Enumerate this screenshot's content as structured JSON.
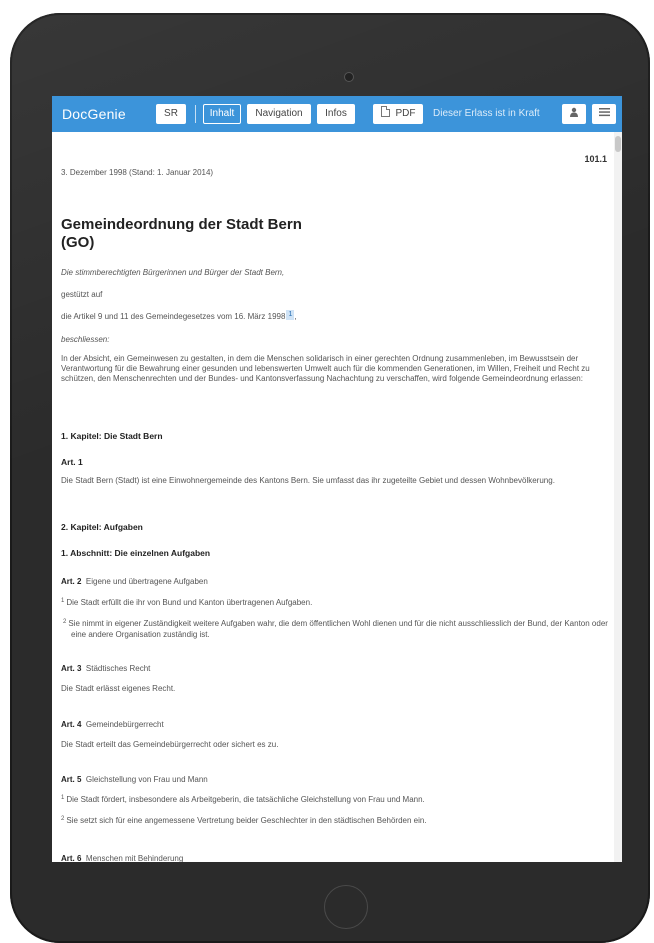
{
  "app": {
    "brand": "DocGenie",
    "buttons": {
      "sr": "SR",
      "inhalt": "Inhalt",
      "navigation": "Navigation",
      "infos": "Infos",
      "pdf": "PDF"
    },
    "status": "Dieser Erlass ist in Kraft",
    "icons": [
      "user-icon",
      "menu-icon",
      "pdf-file-icon",
      "camera-icon",
      "home-button"
    ],
    "colors": {
      "topbar": "#3c94da",
      "device": "#2b2b2b"
    }
  },
  "doc": {
    "sr_number": "101.1",
    "date": "3. Dezember 1998 (Stand: 1. Januar 2014)",
    "title_line1": "Gemeindeordnung der Stadt Bern",
    "title_line2": "(GO)",
    "intro1": "Die stimmberechtigten Bürgerinnen und Bürger der Stadt Bern,",
    "intro2": "gestützt auf",
    "intro3": "die Artikel 9 und 11 des Gemeindegesetzes vom 16. März 1998",
    "intro3_fn": "1",
    "intro3_end": ",",
    "intro4": "beschliessen:",
    "preamble": "In der Absicht, ein Gemeinwesen zu gestalten, in dem die Menschen solidarisch in einer gerechten Ordnung zusammenleben, im Bewusstsein der Verantwortung für die Bewahrung einer gesunden und lebenswerten Umwelt auch für die kommenden Generationen, im Willen, Freiheit und Recht zu schützen, den Menschenrechten und der Bundes- und Kantonsverfassung Nachachtung zu verschaffen, wird folgende Gemeindeordnung erlassen:",
    "chapter1": "1. Kapitel: Die Stadt Bern",
    "art1_title": "Art. 1",
    "art1_text": "Die Stadt Bern (Stadt) ist eine Einwohnergemeinde des Kantons Bern. Sie umfasst das ihr zugeteilte Gebiet und dessen Wohnbevölkerung.",
    "chapter2": "2. Kapitel: Aufgaben",
    "section1": "1. Abschnitt: Die einzelnen Aufgaben",
    "art2_num": "Art. 2",
    "art2_name": "Eigene und übertragene Aufgaben",
    "art2_p1_num": "1",
    "art2_p1": "Die Stadt erfüllt die ihr von Bund und Kanton übertragenen Aufgaben.",
    "art2_p2_num": "2",
    "art2_p2": "Sie nimmt in eigener Zuständigkeit weitere Aufgaben wahr, die dem öffentlichen Wohl dienen und für die nicht ausschliesslich der Bund, der Kanton oder eine andere Organisation zuständig ist.",
    "art3_num": "Art. 3",
    "art3_name": "Städtisches Recht",
    "art3_text": "Die Stadt erlässt eigenes Recht.",
    "art4_num": "Art. 4",
    "art4_name": "Gemeindebürgerrecht",
    "art4_text": "Die Stadt erteilt das Gemeindebürgerrecht oder sichert es zu.",
    "art5_num": "Art. 5",
    "art5_name": "Gleichstellung von Frau und Mann",
    "art5_p1_num": "1",
    "art5_p1": "Die Stadt fördert, insbesondere als Arbeitgeberin, die tatsächliche Gleichstellung von Frau und Mann.",
    "art5_p2_num": "2",
    "art5_p2": "Sie setzt sich für eine angemessene Vertretung beider Geschlechter in den städtischen Behörden ein.",
    "art6_num": "Art. 6",
    "art6_name": "Menschen mit Behinderung"
  }
}
